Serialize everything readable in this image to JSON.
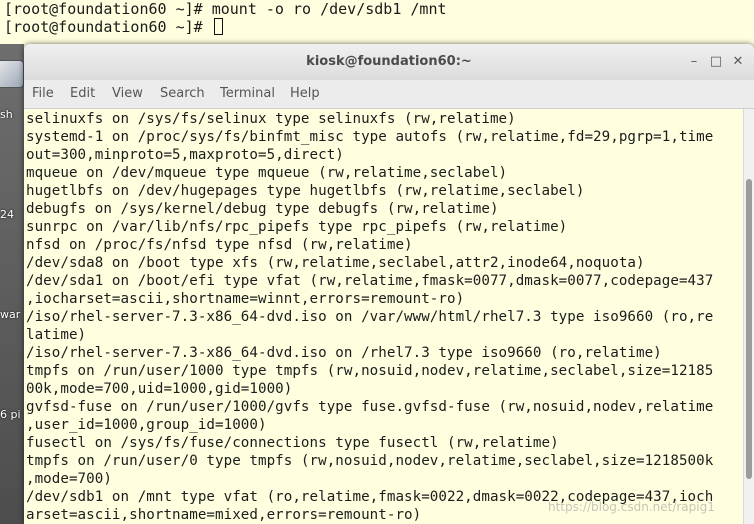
{
  "background_terminal": {
    "lines": [
      "[root@foundation60 ~]# mount -o ro /dev/sdb1 /mnt",
      "[root@foundation60 ~]# "
    ]
  },
  "desktop": {
    "labels": [
      "sh",
      "24",
      "war",
      "6 pi"
    ]
  },
  "window": {
    "title": "kiosk@foundation60:~",
    "controls": {
      "minimize": "–",
      "maximize": "□",
      "close": "✕"
    }
  },
  "menu": [
    "File",
    "Edit",
    "View",
    "Search",
    "Terminal",
    "Help"
  ],
  "terminal": {
    "lines": [
      "selinuxfs on /sys/fs/selinux type selinuxfs (rw,relatime)",
      "systemd-1 on /proc/sys/fs/binfmt_misc type autofs (rw,relatime,fd=29,pgrp=1,time",
      "out=300,minproto=5,maxproto=5,direct)",
      "mqueue on /dev/mqueue type mqueue (rw,relatime,seclabel)",
      "hugetlbfs on /dev/hugepages type hugetlbfs (rw,relatime,seclabel)",
      "debugfs on /sys/kernel/debug type debugfs (rw,relatime)",
      "sunrpc on /var/lib/nfs/rpc_pipefs type rpc_pipefs (rw,relatime)",
      "nfsd on /proc/fs/nfsd type nfsd (rw,relatime)",
      "/dev/sda8 on /boot type xfs (rw,relatime,seclabel,attr2,inode64,noquota)",
      "/dev/sda1 on /boot/efi type vfat (rw,relatime,fmask=0077,dmask=0077,codepage=437",
      ",iocharset=ascii,shortname=winnt,errors=remount-ro)",
      "/iso/rhel-server-7.3-x86_64-dvd.iso on /var/www/html/rhel7.3 type iso9660 (ro,re",
      "latime)",
      "/iso/rhel-server-7.3-x86_64-dvd.iso on /rhel7.3 type iso9660 (ro,relatime)",
      "tmpfs on /run/user/1000 type tmpfs (rw,nosuid,nodev,relatime,seclabel,size=12185",
      "00k,mode=700,uid=1000,gid=1000)",
      "gvfsd-fuse on /run/user/1000/gvfs type fuse.gvfsd-fuse (rw,nosuid,nodev,relatime",
      ",user_id=1000,group_id=1000)",
      "fusectl on /sys/fs/fuse/connections type fusectl (rw,relatime)",
      "tmpfs on /run/user/0 type tmpfs (rw,nosuid,nodev,relatime,seclabel,size=1218500k",
      ",mode=700)",
      "/dev/sdb1 on /mnt type vfat (ro,relatime,fmask=0022,dmask=0022,codepage=437,ioch",
      "arset=ascii,shortname=mixed,errors=remount-ro)"
    ]
  },
  "watermark": "https://blog.csdn.net/rapig1"
}
